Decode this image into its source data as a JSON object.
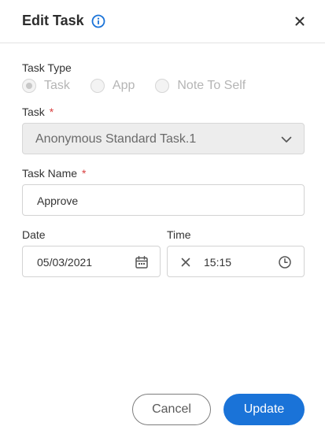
{
  "dialog": {
    "title": "Edit Task",
    "info_icon": "info-circle-icon",
    "close_icon": "close-x-icon",
    "accent_color": "#1a73d8"
  },
  "task_type": {
    "label": "Task Type",
    "options": [
      {
        "label": "Task",
        "selected": true
      },
      {
        "label": "App",
        "selected": false
      },
      {
        "label": "Note To Self",
        "selected": false
      }
    ],
    "disabled": true
  },
  "task": {
    "label": "Task",
    "required_mark": "*",
    "selected": "Anonymous Standard Task.1",
    "icon": "chevron-down-icon",
    "disabled": true
  },
  "task_name": {
    "label": "Task Name",
    "required_mark": "*",
    "value": "Approve"
  },
  "date": {
    "label": "Date",
    "value": "05/03/2021",
    "icon": "calendar-icon"
  },
  "time": {
    "label": "Time",
    "value": "15:15",
    "clear_icon": "clear-x-icon",
    "icon": "clock-icon"
  },
  "actions": {
    "cancel_label": "Cancel",
    "update_label": "Update"
  }
}
